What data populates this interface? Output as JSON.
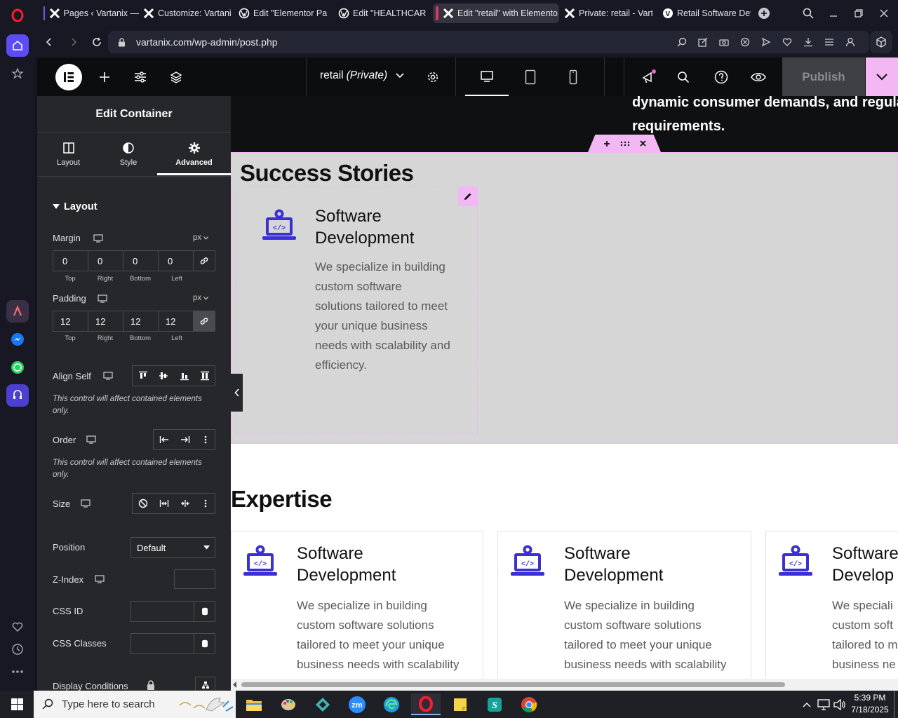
{
  "browser": {
    "tabs": [
      {
        "label": "Pages ‹ Vartanix — ",
        "icon": "elementor-x-icon",
        "accent": "#6c5ce7"
      },
      {
        "label": "Customize: Vartanix",
        "icon": "elementor-x-icon",
        "accent": ""
      },
      {
        "label": "Edit \"Elementor Pag",
        "icon": "wordpress-icon",
        "accent": ""
      },
      {
        "label": "Edit \"HEALTHCARE\"",
        "icon": "wordpress-icon",
        "accent": ""
      },
      {
        "label": "Edit \"retail\" with Elemento",
        "icon": "elementor-x-icon",
        "accent": "#e0355a"
      },
      {
        "label": "Private: retail - Varta",
        "icon": "elementor-x-icon",
        "accent": ""
      },
      {
        "label": "Retail Software Dev",
        "icon": "site-icon",
        "accent": ""
      }
    ],
    "url": "vartanix.com/wp-admin/post.php"
  },
  "topbar": {
    "page_name": "retail",
    "page_status": "(Private)",
    "publish_label": "Publish"
  },
  "panel": {
    "title": "Edit Container",
    "tabs": {
      "layout": "Layout",
      "style": "Style",
      "advanced": "Advanced"
    },
    "section_title": "Layout",
    "margin": {
      "label": "Margin",
      "unit": "px",
      "top": "0",
      "right": "0",
      "bottom": "0",
      "left": "0"
    },
    "padding": {
      "label": "Padding",
      "unit": "px",
      "top": "12",
      "right": "12",
      "bottom": "12",
      "left": "12"
    },
    "sides": {
      "top": "Top",
      "right": "Right",
      "bottom": "Bottom",
      "left": "Left"
    },
    "align_self": {
      "label": "Align Self",
      "note": "This control will affect contained elements only."
    },
    "order": {
      "label": "Order",
      "note": "This control will affect contained elements only."
    },
    "size": {
      "label": "Size"
    },
    "position": {
      "label": "Position",
      "value": "Default"
    },
    "zindex": {
      "label": "Z-Index",
      "value": ""
    },
    "css_id": {
      "label": "CSS ID",
      "value": ""
    },
    "css_classes": {
      "label": "CSS Classes",
      "value": ""
    },
    "display_conditions": {
      "label": "Display Conditions"
    }
  },
  "canvas": {
    "top_text_line1": "dynamic consumer demands, and regula",
    "top_text_line2": "requirements.",
    "success_heading": "Success Stories",
    "success_card": {
      "title_line1": "Software",
      "title_line2": "Development",
      "desc_lines": [
        "We specialize in building",
        "custom software",
        "solutions tailored to meet",
        "your unique business",
        "needs with scalability and",
        "efficiency."
      ]
    },
    "expertise_heading": "Expertise",
    "expertise_cards": [
      {
        "title_line1": "Software",
        "title_line2": "Development",
        "desc_lines": [
          "We specialize in building",
          "custom software solutions",
          "tailored to meet your unique",
          "business needs with scalability"
        ]
      },
      {
        "title_line1": "Software",
        "title_line2": "Development",
        "desc_lines": [
          "We specialize in building",
          "custom software solutions",
          "tailored to meet your unique",
          "business needs with scalability"
        ]
      },
      {
        "title_line1": "Software",
        "title_line2": "Develop",
        "desc_lines": [
          "We speciali",
          "custom soft",
          "tailored to m",
          "business ne"
        ]
      }
    ]
  },
  "taskbar": {
    "search_placeholder": "Type here to search",
    "time": "5:39 PM",
    "date": "7/18/2025"
  },
  "colors": {
    "accent_pink": "#f3b7f4",
    "icon_blue": "#3b2fd6",
    "canvas_gray": "#d6d6d6",
    "panel_bg": "#26272b"
  }
}
